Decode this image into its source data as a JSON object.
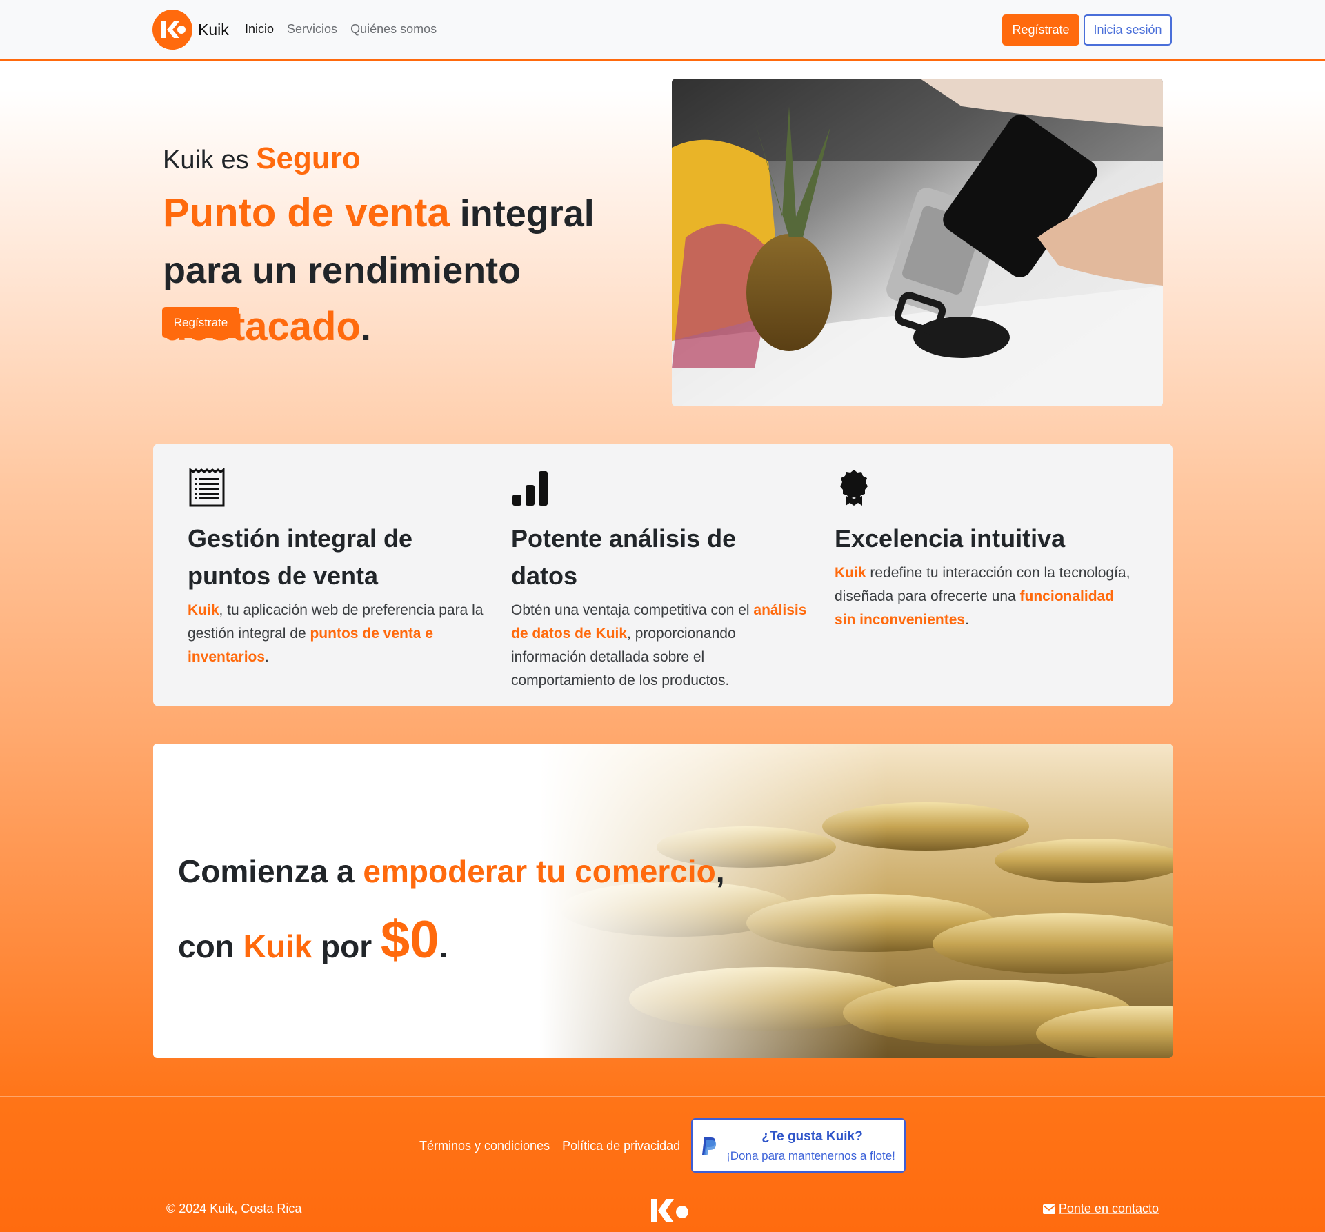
{
  "nav": {
    "brand": "Kuik",
    "links": [
      "Inicio",
      "Servicios",
      "Quiénes somos"
    ],
    "register": "Regístrate",
    "login": "Inicia sesión"
  },
  "hero": {
    "prefix": "Kuik es ",
    "adjective": "Seguro",
    "accent1": "Punto de venta",
    "mid": " integral para un rendimiento ",
    "accent2": "destacado",
    "end": ".",
    "button": "Regístrate"
  },
  "features": [
    {
      "icon": "receipt-icon",
      "title": "Gestión integral de puntos de venta",
      "parts": [
        "Kuik",
        ", tu aplicación web de preferencia para la gestión integral de ",
        "puntos de venta e inventarios",
        "."
      ]
    },
    {
      "icon": "bar-chart-icon",
      "title": "Potente análisis de datos",
      "parts": [
        "Obtén una ventaja competitiva con el ",
        "análisis de datos de Kuik",
        ", proporcionando información detallada sobre el comportamiento de los productos."
      ]
    },
    {
      "icon": "award-icon",
      "title": "Excelencia intuitiva",
      "parts": [
        "Kuik",
        " redefine tu interacción con la tecnología, diseñada para ofrecerte una ",
        "funcionalidad sin inconvenientes",
        "."
      ]
    }
  ],
  "cta": {
    "l1_a": "Comienza a ",
    "l1_b": "empoderar tu comercio",
    "l1_c": ",",
    "l2_a": "con ",
    "l2_b": "Kuik",
    "l2_c": " por ",
    "l2_d": "$0",
    "l2_e": "."
  },
  "footer": {
    "terms": "Términos y condiciones",
    "privacy": "Política de privacidad",
    "donate_title": "¿Te gusta Kuik?",
    "donate_sub": "¡Dona para mantenernos a flote!",
    "copyright": "© 2024 Kuik, Costa Rica",
    "contact": "Ponte en contacto"
  },
  "colors": {
    "accent": "#ff6a0d",
    "login_blue": "#4a6fd9",
    "text": "#212529"
  }
}
